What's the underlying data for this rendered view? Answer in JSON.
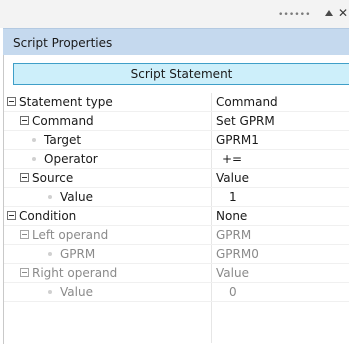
{
  "toolbar": {
    "grip_text": "••••••",
    "pin_icon": "triangle-up-icon",
    "close_icon": "close-icon",
    "close_text": "✕"
  },
  "panel": {
    "title": "Script Properties",
    "statement_button": "Script Statement"
  },
  "rows": [
    {
      "label": "Statement type",
      "value": "Command",
      "kind": "expander",
      "muted": false
    },
    {
      "label": "Command",
      "value": "Set GPRM",
      "kind": "expander",
      "muted": false
    },
    {
      "label": "Target",
      "value": "GPRM1",
      "kind": "leaf",
      "muted": false
    },
    {
      "label": "Operator",
      "value": "+=",
      "kind": "leaf",
      "muted": false
    },
    {
      "label": "Source",
      "value": "Value",
      "kind": "expander",
      "muted": false
    },
    {
      "label": "Value",
      "value": "1",
      "kind": "leaf",
      "muted": false
    },
    {
      "label": "Condition",
      "value": "None",
      "kind": "expander",
      "muted": false
    },
    {
      "label": "Left operand",
      "value": "GPRM",
      "kind": "expander",
      "muted": true
    },
    {
      "label": "GPRM",
      "value": "GPRM0",
      "kind": "leaf",
      "muted": true
    },
    {
      "label": "Right operand",
      "value": "Value",
      "kind": "expander",
      "muted": true
    },
    {
      "label": "Value",
      "value": "0",
      "kind": "leaf",
      "muted": true
    }
  ],
  "colors": {
    "header_bg": "#c5d9ee",
    "button_bg": "#cdeffa",
    "button_border": "#3f9fc8",
    "muted_text": "#8a8a8a"
  }
}
